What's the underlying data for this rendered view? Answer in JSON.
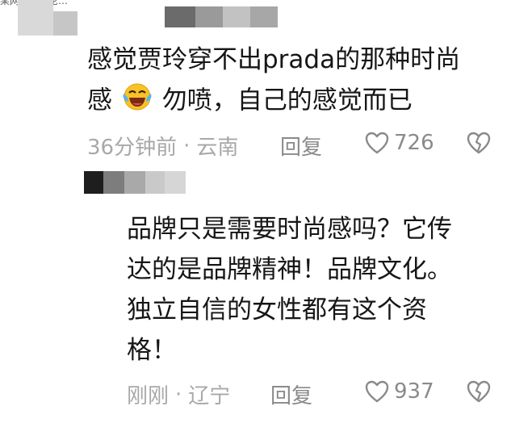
{
  "top_fragment": "某网友的评论…",
  "comment1": {
    "line1": "感觉贾玲穿不出prada的那种时尚",
    "line2_pre": "感",
    "line2_post": "勿喷，自己的感觉而已",
    "emoji": "laughing-crying-emoji",
    "time": "36分钟前",
    "location": "云南",
    "reply_label": "回复",
    "likes": "726"
  },
  "comment2": {
    "lines": [
      "品牌只是需要时尚感吗？它传",
      "达的是品牌精神！品牌文化。",
      "独立自信的女性都有这个资",
      "格！"
    ],
    "time": "刚刚",
    "location": "辽宁",
    "reply_label": "回复",
    "likes": "937"
  },
  "separator": "·",
  "colors": {
    "text": "#161616",
    "meta": "#a8a8a8",
    "icon": "#8a8a8a"
  }
}
